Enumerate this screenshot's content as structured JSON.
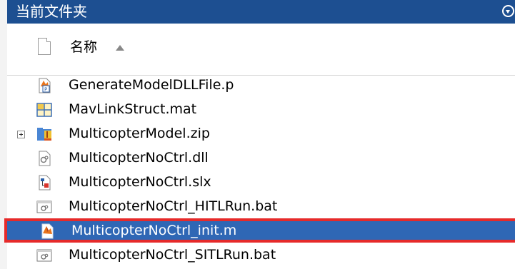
{
  "panel": {
    "title": "当前文件夹",
    "collapse_icon": "circle-chevron-down-icon"
  },
  "columns": {
    "name_label": "名称",
    "sort_icon": "sort-ascending-icon"
  },
  "files": [
    {
      "name": "GenerateModelDLLFile.p",
      "icon": "matlab-p-file-icon"
    },
    {
      "name": "MavLinkStruct.mat",
      "icon": "mat-file-icon"
    },
    {
      "name": "MulticopterModel.zip",
      "icon": "zip-archive-icon",
      "expandable": true
    },
    {
      "name": "MulticopterNoCtrl.dll",
      "icon": "dll-file-icon"
    },
    {
      "name": "MulticopterNoCtrl.slx",
      "icon": "simulink-model-icon"
    },
    {
      "name": "MulticopterNoCtrl_HITLRun.bat",
      "icon": "batch-file-icon"
    },
    {
      "name": "MulticopterNoCtrl_init.m",
      "icon": "matlab-script-icon",
      "selected": true
    },
    {
      "name": "MulticopterNoCtrl_SITLRun.bat",
      "icon": "batch-file-icon"
    }
  ],
  "colors": {
    "titlebar": "#1d4f91",
    "selection": "#2f67b5",
    "highlight_border": "#e62a2a"
  }
}
